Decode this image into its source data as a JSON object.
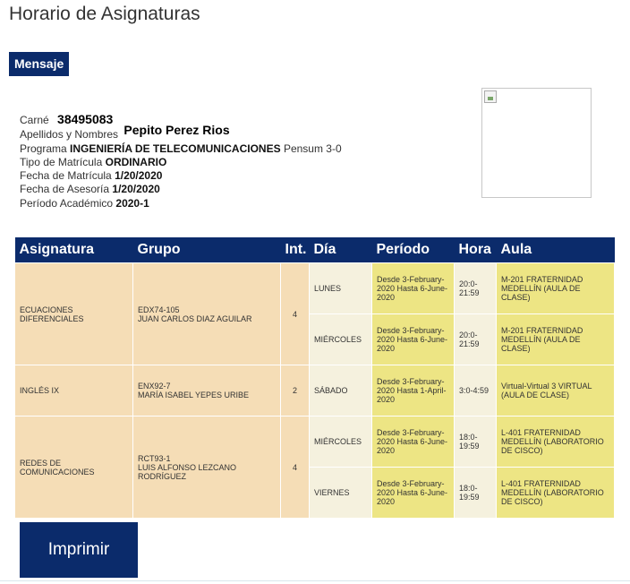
{
  "page": {
    "title": "Horario de Asignaturas"
  },
  "message": {
    "label": "Mensaje"
  },
  "student": {
    "carne_label": "Carné",
    "carne_value": "38495083",
    "name_label": "Apellidos y Nombres",
    "name_value": "Pepito Perez Rios",
    "program_label": "Programa",
    "program_value": "INGENIERÍA DE TELECOMUNICACIONES",
    "pensum": "Pensum 3-0",
    "type_label": "Tipo de Matrícula",
    "type_value": "ORDINARIO",
    "enroll_date_label": "Fecha de Matrícula",
    "enroll_date_value": "1/20/2020",
    "advice_date_label": "Fecha de Asesoría",
    "advice_date_value": "1/20/2020",
    "period_label": "Período Académico",
    "period_value": "2020-1"
  },
  "table": {
    "headers": {
      "subject": "Asignatura",
      "group": "Grupo",
      "intensity": "Int.",
      "day": "Día",
      "period": "Período",
      "hour": "Hora",
      "room": "Aula"
    },
    "courses": [
      {
        "subject": "ECUACIONES DIFERENCIALES",
        "group_code": "EDX74-105",
        "teacher": "JUAN CARLOS DIAZ AGUILAR",
        "intensity": "4",
        "sessions": [
          {
            "day": "LUNES",
            "period": "Desde 3-February-2020 Hasta 6-June-2020",
            "hour": "20:0-21:59",
            "room": "M-201 FRATERNIDAD MEDELLÍN (AULA DE CLASE)"
          },
          {
            "day": "MIÉRCOLES",
            "period": "Desde 3-February-2020 Hasta 6-June-2020",
            "hour": "20:0-21:59",
            "room": "M-201 FRATERNIDAD MEDELLÍN (AULA DE CLASE)"
          }
        ]
      },
      {
        "subject": "INGLÉS IX",
        "group_code": "ENX92-7",
        "teacher": "MARÍA ISABEL YEPES URIBE",
        "intensity": "2",
        "sessions": [
          {
            "day": "SÁBADO",
            "period": "Desde 3-February-2020 Hasta 1-April-2020",
            "hour": "3:0-4:59",
            "room": "Virtual-Virtual 3 VIRTUAL (AULA DE CLASE)"
          }
        ]
      },
      {
        "subject": "REDES DE COMUNICACIONES",
        "group_code": "RCT93-1",
        "teacher": "LUIS ALFONSO LEZCANO RODRÍGUEZ",
        "intensity": "4",
        "sessions": [
          {
            "day": "MIÉRCOLES",
            "period": "Desde 3-February-2020 Hasta 6-June-2020",
            "hour": "18:0-19:59",
            "room": "L-401 FRATERNIDAD MEDELLÍN (LABORATORIO DE CISCO)"
          },
          {
            "day": "VIERNES",
            "period": "Desde 3-February-2020 Hasta 6-June-2020",
            "hour": "18:0-19:59",
            "room": "L-401 FRATERNIDAD MEDELLÍN (LABORATORIO DE CISCO)"
          }
        ]
      }
    ]
  },
  "actions": {
    "print_label": "Imprimir"
  },
  "colors": {
    "header_bg": "#0b2b6b",
    "subject_bg": "#f5ddb6",
    "day_bg": "#f5f1de",
    "period_bg": "#ede584"
  }
}
